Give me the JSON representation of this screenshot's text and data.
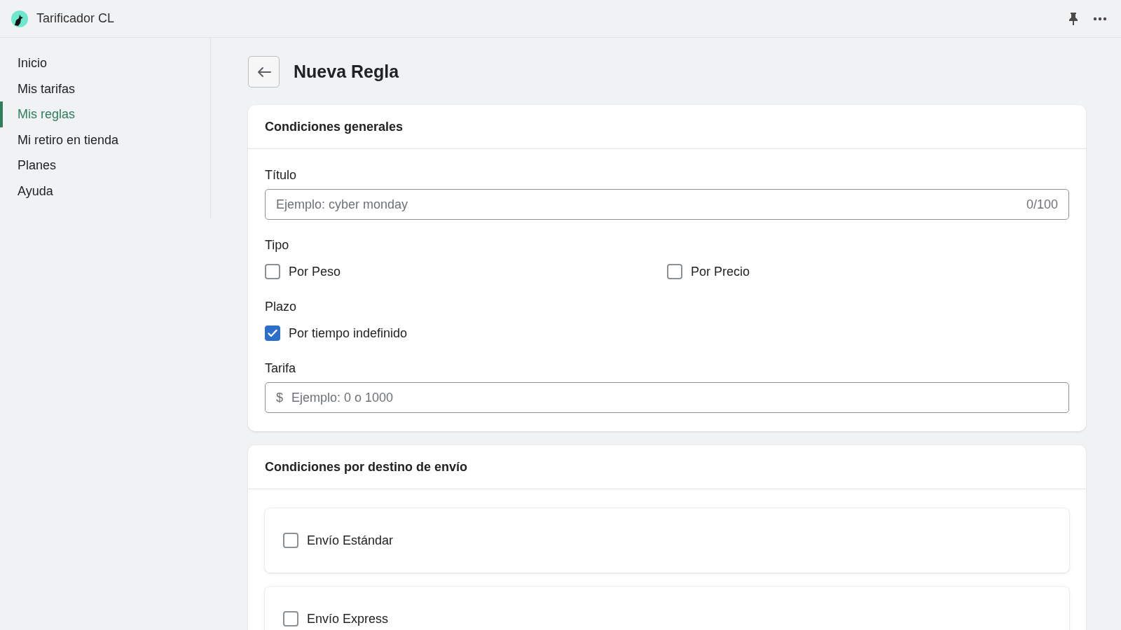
{
  "app": {
    "name": "Tarificador CL"
  },
  "sidebar": {
    "items": [
      {
        "label": "Inicio",
        "selected": false
      },
      {
        "label": "Mis tarifas",
        "selected": false
      },
      {
        "label": "Mis reglas",
        "selected": true
      },
      {
        "label": "Mi retiro en tienda",
        "selected": false
      },
      {
        "label": "Planes",
        "selected": false
      },
      {
        "label": "Ayuda",
        "selected": false
      }
    ]
  },
  "page": {
    "title": "Nueva Regla"
  },
  "general_card": {
    "title": "Condiciones generales",
    "fields": [
      {
        "kind": "text",
        "label": "Título",
        "placeholder": "Ejemplo: cyber monday",
        "counter": "0/100"
      },
      {
        "kind": "checkgroup",
        "label": "Tipo",
        "options": [
          {
            "label": "Por Peso",
            "checked": false
          },
          {
            "label": "Por Precio",
            "checked": false
          }
        ]
      },
      {
        "kind": "checkgroup",
        "label": "Plazo",
        "options": [
          {
            "label": "Por tiempo indefinido",
            "checked": true
          }
        ]
      },
      {
        "kind": "money",
        "label": "Tarifa",
        "prefix": "$",
        "placeholder": "Ejemplo: 0 o 1000"
      }
    ]
  },
  "destination_card": {
    "title": "Condiciones por destino de envío",
    "options": [
      {
        "label": "Envío Estándar",
        "checked": false
      },
      {
        "label": "Envío Express",
        "checked": false
      }
    ]
  }
}
